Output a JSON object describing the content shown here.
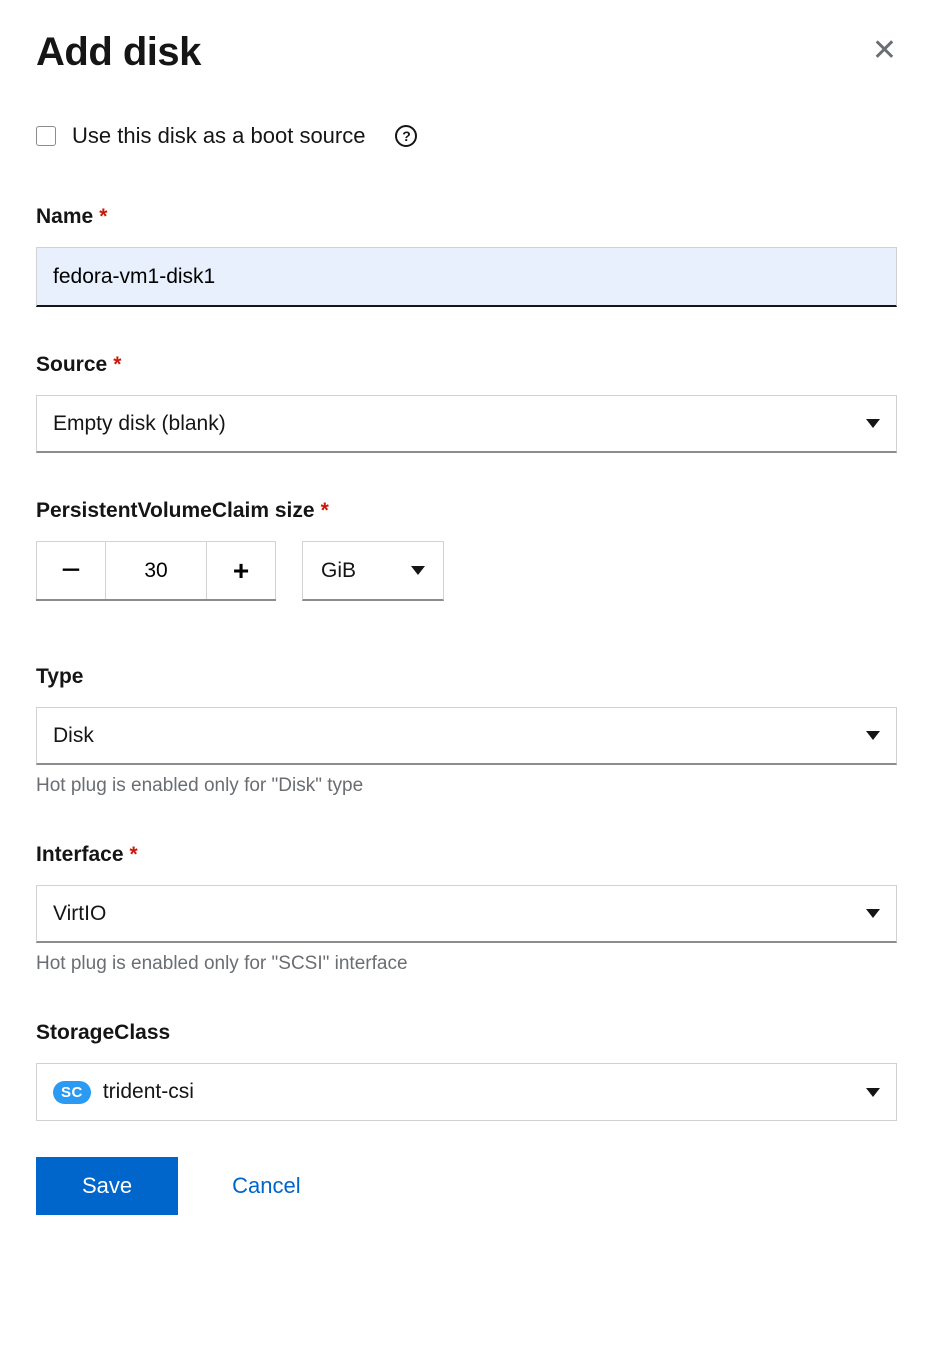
{
  "dialog": {
    "title": "Add disk",
    "bootSourceLabel": "Use this disk as a boot source"
  },
  "name": {
    "label": "Name",
    "value": "fedora-vm1-disk1"
  },
  "source": {
    "label": "Source",
    "selected": "Empty disk (blank)"
  },
  "pvc": {
    "label": "PersistentVolumeClaim size",
    "value": "30",
    "unit": "GiB"
  },
  "type": {
    "label": "Type",
    "selected": "Disk",
    "helper": "Hot plug is enabled only for \"Disk\" type"
  },
  "interface": {
    "label": "Interface",
    "selected": "VirtIO",
    "helper": "Hot plug is enabled only for \"SCSI\" interface"
  },
  "storageClass": {
    "label": "StorageClass",
    "badge": "SC",
    "selected": "trident-csi"
  },
  "footer": {
    "save": "Save",
    "cancel": "Cancel"
  }
}
